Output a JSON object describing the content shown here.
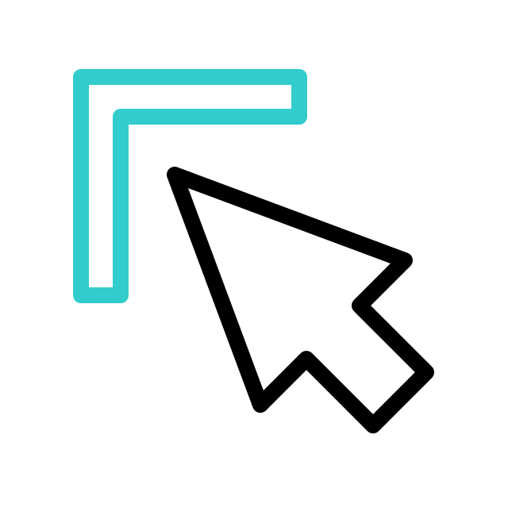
{
  "icon": {
    "name": "cursor-corner-select-icon",
    "parts": [
      {
        "name": "corner-bracket-icon",
        "color": "#33cccc"
      },
      {
        "name": "mouse-pointer-icon",
        "color": "#000000"
      }
    ]
  },
  "colors": {
    "accent": "#33cccc",
    "stroke": "#000000",
    "background": "#ffffff"
  }
}
